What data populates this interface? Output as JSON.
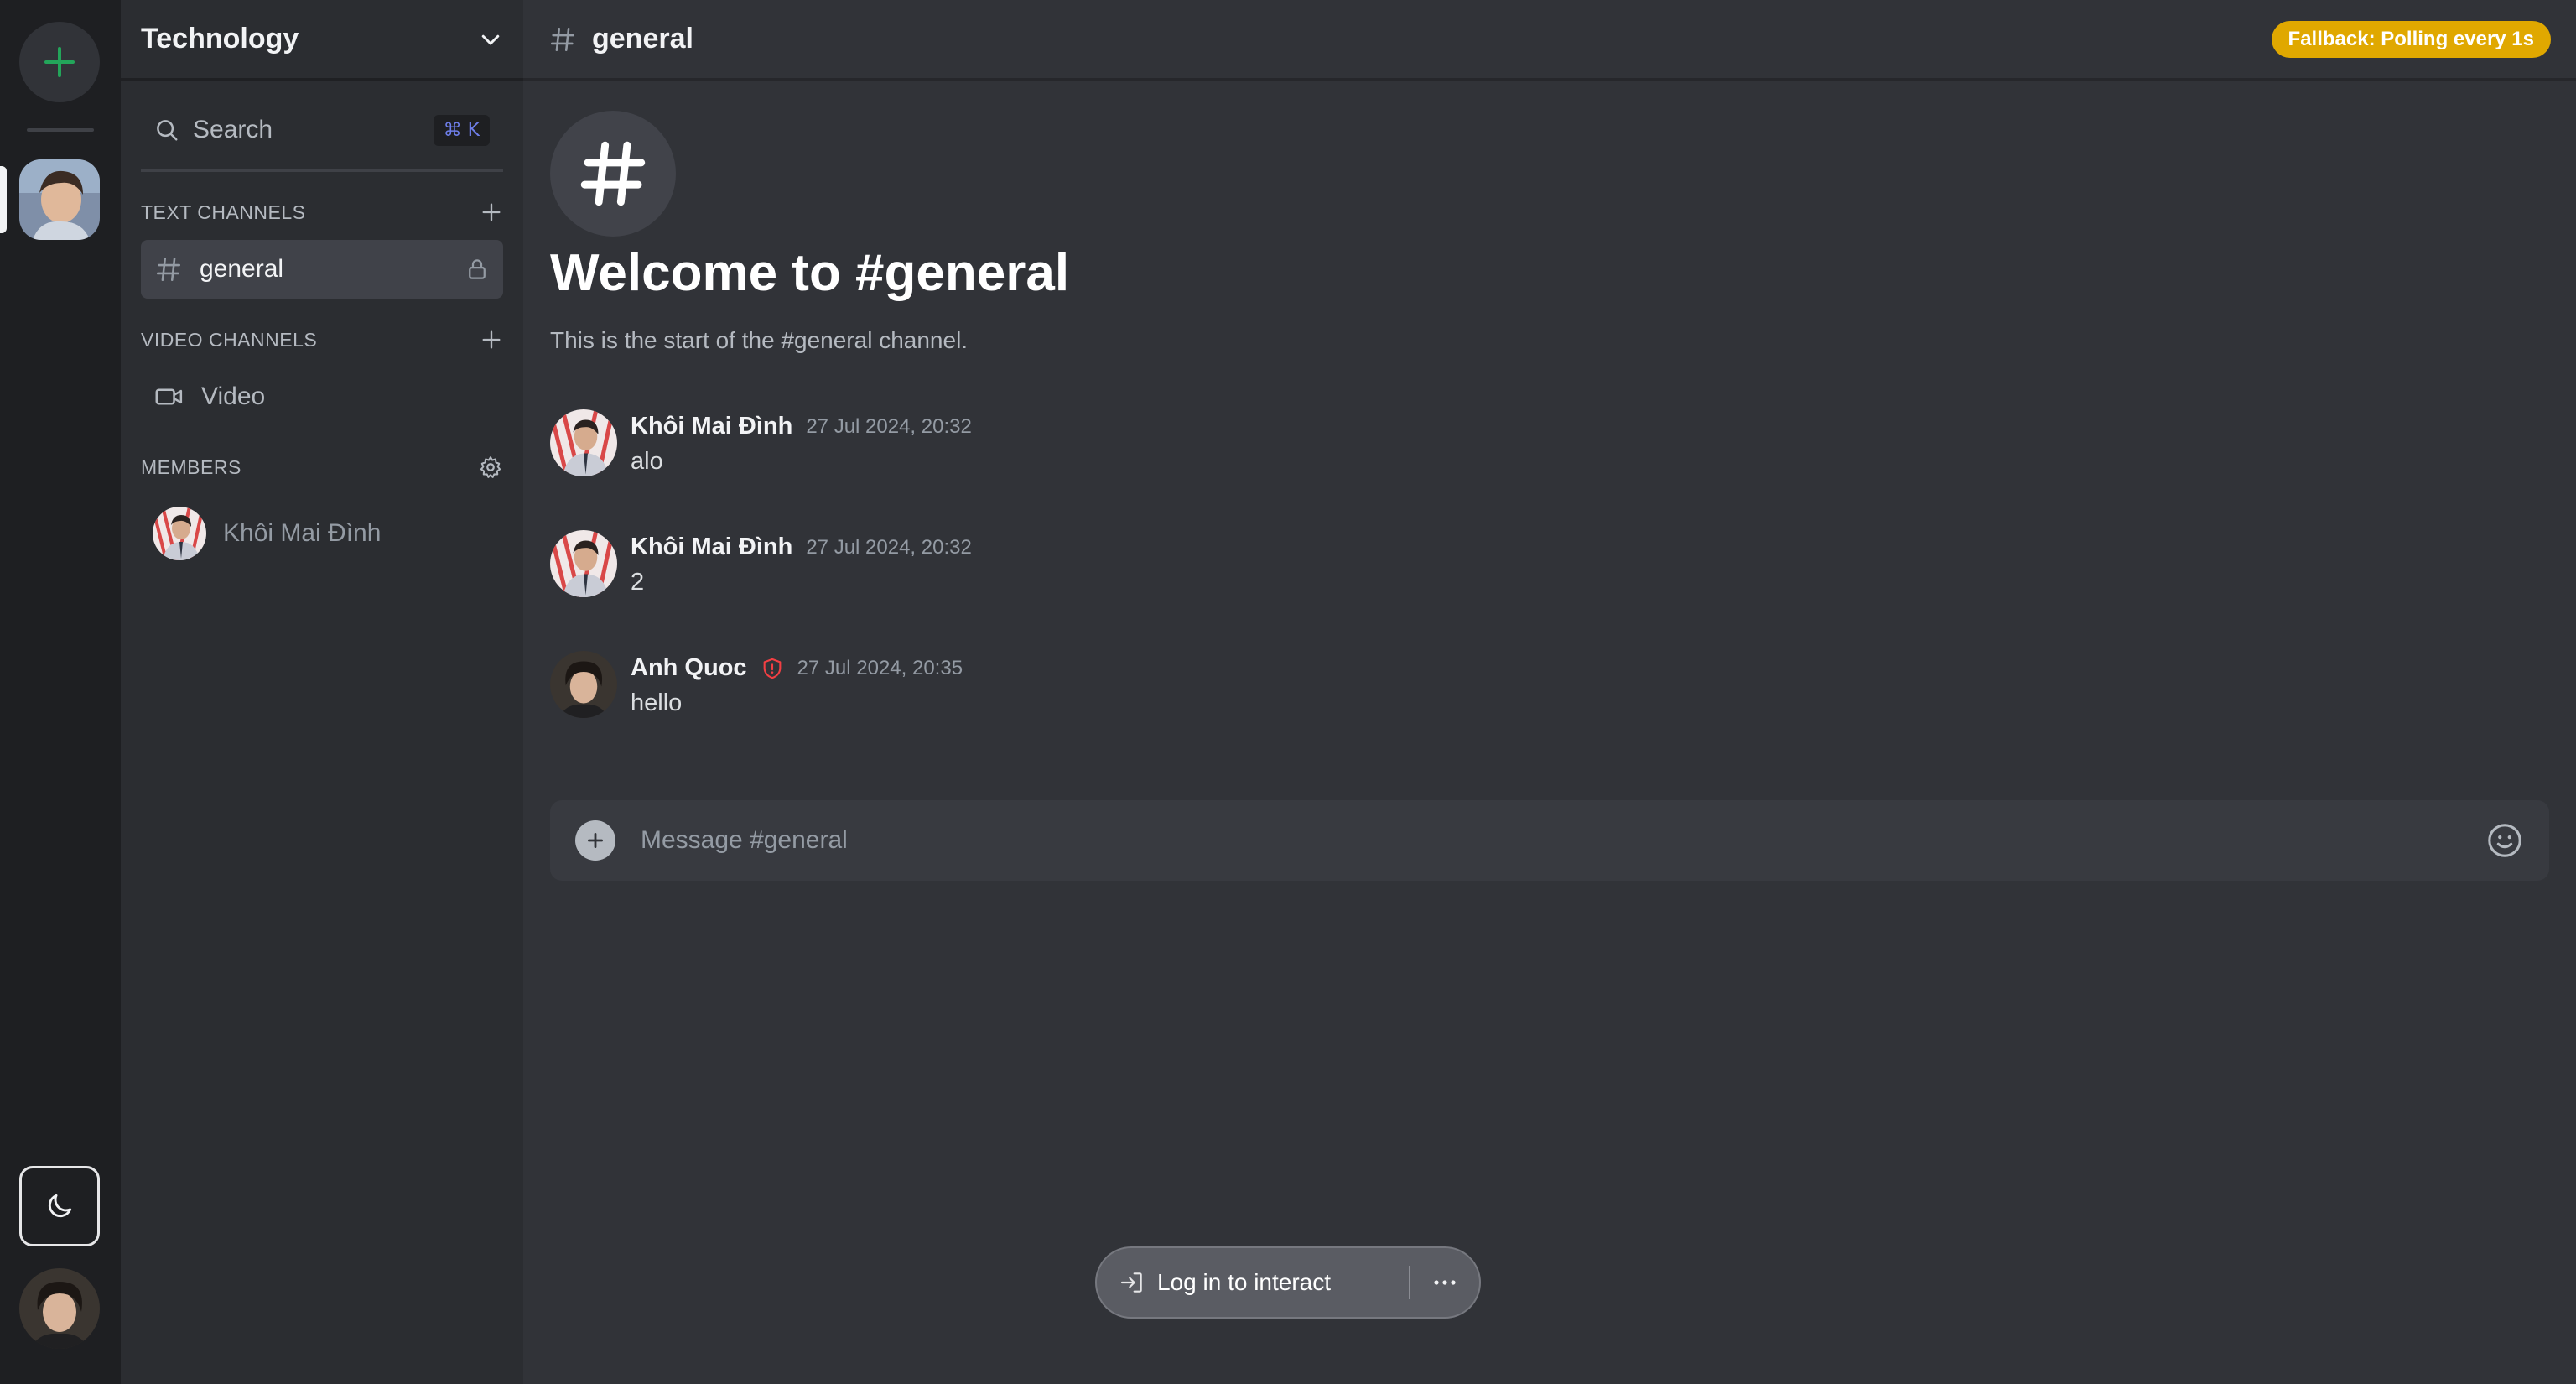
{
  "rail": {
    "add_server_icon": "plus-icon",
    "server_icon": "server-avatar-photo",
    "theme_toggle_icon": "moon-icon",
    "user_avatar": "user-avatar-photo"
  },
  "sidebar": {
    "server_name": "Technology",
    "search": {
      "label": "Search",
      "shortcut": "⌘ K"
    },
    "text_channels": {
      "title": "TEXT CHANNELS",
      "items": [
        {
          "label": "general",
          "icon": "hash-icon",
          "locked": true,
          "active": true
        }
      ]
    },
    "video_channels": {
      "title": "VIDEO CHANNELS",
      "items": [
        {
          "label": "Video",
          "icon": "video-icon"
        }
      ]
    },
    "members": {
      "title": "MEMBERS",
      "items": [
        {
          "name": "Khôi Mai Đình"
        }
      ]
    }
  },
  "header": {
    "channel": "general",
    "badge": "Fallback: Polling every 1s"
  },
  "welcome": {
    "title": "Welcome to #general",
    "subtitle": "This is the start of the #general channel."
  },
  "messages": [
    {
      "author": "Khôi Mai Đình",
      "time": "27 Jul 2024, 20:32",
      "text": "alo",
      "admin": false
    },
    {
      "author": "Khôi Mai Đình",
      "time": "27 Jul 2024, 20:32",
      "text": "2",
      "admin": false
    },
    {
      "author": "Anh Quoc",
      "time": "27 Jul 2024, 20:35",
      "text": "hello",
      "admin": true
    }
  ],
  "composer": {
    "placeholder": "Message #general"
  },
  "login_pill": {
    "label": "Log in to interact"
  },
  "colors": {
    "accent_green": "#23a55a",
    "badge": "#e0a800",
    "admin_shield": "#f23f43"
  }
}
